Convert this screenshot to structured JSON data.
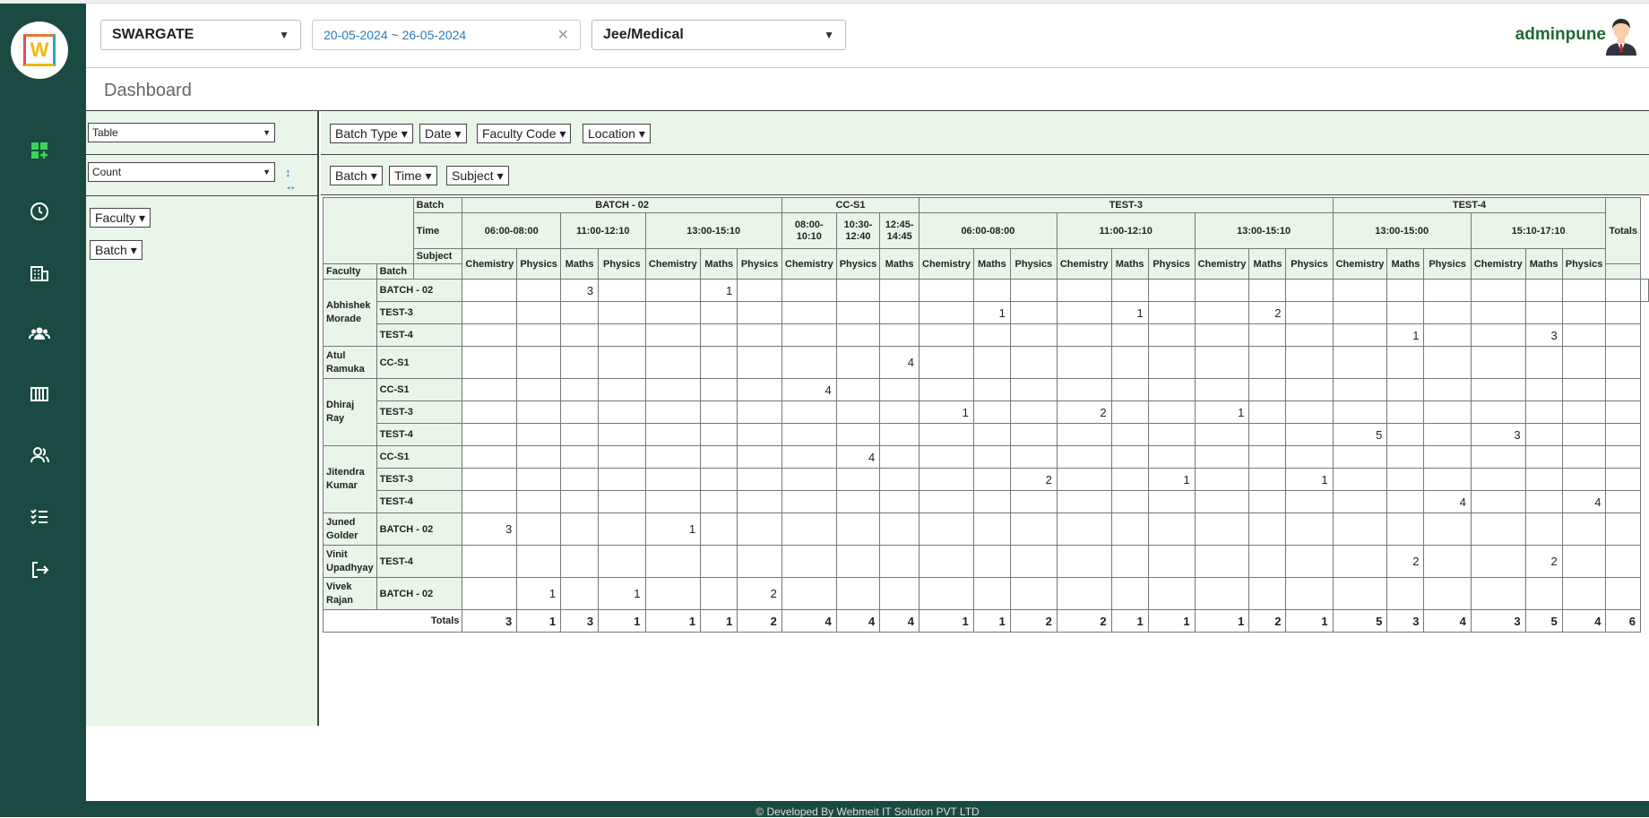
{
  "app": {
    "title": "Dashboard",
    "logo_letter": "W",
    "logo_colors": [
      "#e07a2c",
      "#2aa3c8",
      "#f0b90b",
      "#d9534f"
    ]
  },
  "sidebar": {
    "items": [
      {
        "icon": "dashboard-icon",
        "active": true
      },
      {
        "icon": "clock-icon"
      },
      {
        "icon": "building-icon"
      },
      {
        "icon": "users-group-icon"
      },
      {
        "icon": "columns-icon"
      },
      {
        "icon": "user-icon"
      },
      {
        "icon": "checklist-icon"
      },
      {
        "icon": "logout-icon"
      }
    ]
  },
  "header": {
    "branch": "SWARGATE",
    "daterange": "20-05-2024 ~ 26-05-2024",
    "course": "Jee/Medical",
    "username": "adminpune"
  },
  "pivot": {
    "renderer": "Table",
    "aggregator": "Count",
    "sort_icons": "↕ ↔",
    "unused_attrs": [
      "Batch Type",
      "Date",
      "Faculty Code",
      "Location"
    ],
    "col_attrs": [
      "Batch",
      "Time",
      "Subject"
    ],
    "row_attrs": [
      "Faculty",
      "Batch"
    ],
    "dropdown_suffix": "▾"
  },
  "table": {
    "header_labels": {
      "batch": "Batch",
      "time": "Time",
      "subject": "Subject",
      "faculty": "Faculty",
      "row_batch": "Batch",
      "totals": "Totals",
      "total_col": "Totals"
    },
    "batches": [
      {
        "name": "BATCH - 02",
        "times": [
          {
            "time": "06:00-08:00",
            "subjects": [
              "Chemistry",
              "Physics"
            ]
          },
          {
            "time": "11:00-12:10",
            "subjects": [
              "Maths",
              "Physics"
            ]
          },
          {
            "time": "13:00-15:10",
            "subjects": [
              "Chemistry",
              "Maths",
              "Physics"
            ]
          }
        ]
      },
      {
        "name": "CC-S1",
        "times": [
          {
            "time": "08:00-10:10",
            "subjects": [
              "Chemistry"
            ]
          },
          {
            "time": "10:30-12:40",
            "subjects": [
              "Physics"
            ]
          },
          {
            "time": "12:45-14:45",
            "subjects": [
              "Maths"
            ]
          }
        ]
      },
      {
        "name": "TEST-3",
        "times": [
          {
            "time": "06:00-08:00",
            "subjects": [
              "Chemistry",
              "Maths",
              "Physics"
            ]
          },
          {
            "time": "11:00-12:10",
            "subjects": [
              "Chemistry",
              "Maths",
              "Physics"
            ]
          },
          {
            "time": "13:00-15:10",
            "subjects": [
              "Chemistry",
              "Maths",
              "Physics"
            ]
          }
        ]
      },
      {
        "name": "TEST-4",
        "times": [
          {
            "time": "13:00-15:00",
            "subjects": [
              "Chemistry",
              "Maths",
              "Physics"
            ]
          },
          {
            "time": "15:10-17:10",
            "subjects": [
              "Chemistry",
              "Maths",
              "Physics"
            ]
          }
        ]
      }
    ],
    "faculty_groups": [
      {
        "faculty": "Abhishek Morade",
        "rows": [
          {
            "batch": "BATCH - 02",
            "values": [
              "",
              "",
              "3",
              "",
              "",
              "1",
              "",
              "",
              "",
              "",
              "",
              "",
              "",
              "",
              "",
              "",
              "",
              "",
              "",
              "",
              "",
              "",
              "",
              "",
              "",
              ""
            ]
          },
          {
            "batch": "TEST-3",
            "values": [
              "",
              "",
              "",
              "",
              "",
              "",
              "",
              "",
              "",
              "",
              "",
              "1",
              "",
              "",
              "1",
              "",
              "",
              "2",
              "",
              "",
              "",
              "",
              "",
              "",
              ""
            ]
          },
          {
            "batch": "TEST-4",
            "values": [
              "",
              "",
              "",
              "",
              "",
              "",
              "",
              "",
              "",
              "",
              "",
              "",
              "",
              "",
              "",
              "",
              "",
              "",
              "",
              "",
              "1",
              "",
              "",
              "3",
              ""
            ]
          }
        ]
      },
      {
        "faculty": "Atul Ramuka",
        "rows": [
          {
            "batch": "CC-S1",
            "values": [
              "",
              "",
              "",
              "",
              "",
              "",
              "",
              "",
              "",
              "4",
              "",
              "",
              "",
              "",
              "",
              "",
              "",
              "",
              "",
              "",
              "",
              "",
              "",
              "",
              ""
            ]
          }
        ]
      },
      {
        "faculty": "Dhiraj Ray",
        "rows": [
          {
            "batch": "CC-S1",
            "values": [
              "",
              "",
              "",
              "",
              "",
              "",
              "",
              "4",
              "",
              "",
              "",
              "",
              "",
              "",
              "",
              "",
              "",
              "",
              "",
              "",
              "",
              "",
              "",
              "",
              ""
            ]
          },
          {
            "batch": "TEST-3",
            "values": [
              "",
              "",
              "",
              "",
              "",
              "",
              "",
              "",
              "",
              "",
              "1",
              "",
              "",
              "2",
              "",
              "",
              "1",
              "",
              "",
              "",
              "",
              "",
              "",
              "",
              ""
            ]
          },
          {
            "batch": "TEST-4",
            "values": [
              "",
              "",
              "",
              "",
              "",
              "",
              "",
              "",
              "",
              "",
              "",
              "",
              "",
              "",
              "",
              "",
              "",
              "",
              "",
              "5",
              "",
              "",
              "3",
              "",
              ""
            ]
          }
        ]
      },
      {
        "faculty": "Jitendra Kumar",
        "rows": [
          {
            "batch": "CC-S1",
            "values": [
              "",
              "",
              "",
              "",
              "",
              "",
              "",
              "",
              "4",
              "",
              "",
              "",
              "",
              "",
              "",
              "",
              "",
              "",
              "",
              "",
              "",
              "",
              "",
              "",
              ""
            ]
          },
          {
            "batch": "TEST-3",
            "values": [
              "",
              "",
              "",
              "",
              "",
              "",
              "",
              "",
              "",
              "",
              "",
              "",
              "2",
              "",
              "",
              "1",
              "",
              "",
              "1",
              "",
              "",
              "",
              "",
              "",
              ""
            ]
          },
          {
            "batch": "TEST-4",
            "values": [
              "",
              "",
              "",
              "",
              "",
              "",
              "",
              "",
              "",
              "",
              "",
              "",
              "",
              "",
              "",
              "",
              "",
              "",
              "",
              "",
              "",
              "4",
              "",
              "",
              "4"
            ]
          }
        ]
      },
      {
        "faculty": "Juned Golder",
        "rows": [
          {
            "batch": "BATCH - 02",
            "values": [
              "3",
              "",
              "",
              "",
              "1",
              "",
              "",
              "",
              "",
              "",
              "",
              "",
              "",
              "",
              "",
              "",
              "",
              "",
              "",
              "",
              "",
              "",
              "",
              "",
              ""
            ]
          }
        ]
      },
      {
        "faculty": "Vinit Upadhyay",
        "rows": [
          {
            "batch": "TEST-4",
            "values": [
              "",
              "",
              "",
              "",
              "",
              "",
              "",
              "",
              "",
              "",
              "",
              "",
              "",
              "",
              "",
              "",
              "",
              "",
              "",
              "",
              "2",
              "",
              "",
              "2",
              ""
            ]
          }
        ]
      },
      {
        "faculty": "Vivek Rajan",
        "rows": [
          {
            "batch": "BATCH - 02",
            "values": [
              "",
              "1",
              "",
              "1",
              "",
              "",
              "2",
              "",
              "",
              "",
              "",
              "",
              "",
              "",
              "",
              "",
              "",
              "",
              "",
              "",
              "",
              "",
              "",
              "",
              ""
            ]
          }
        ]
      }
    ],
    "col_totals": [
      "3",
      "1",
      "3",
      "1",
      "1",
      "1",
      "2",
      "4",
      "4",
      "4",
      "1",
      "1",
      "2",
      "2",
      "1",
      "1",
      "1",
      "2",
      "1",
      "5",
      "3",
      "4",
      "3",
      "5",
      "4"
    ],
    "grand_total": "6"
  },
  "footer": {
    "text": "© Developed By Webmeit IT Solution PVT LTD"
  }
}
